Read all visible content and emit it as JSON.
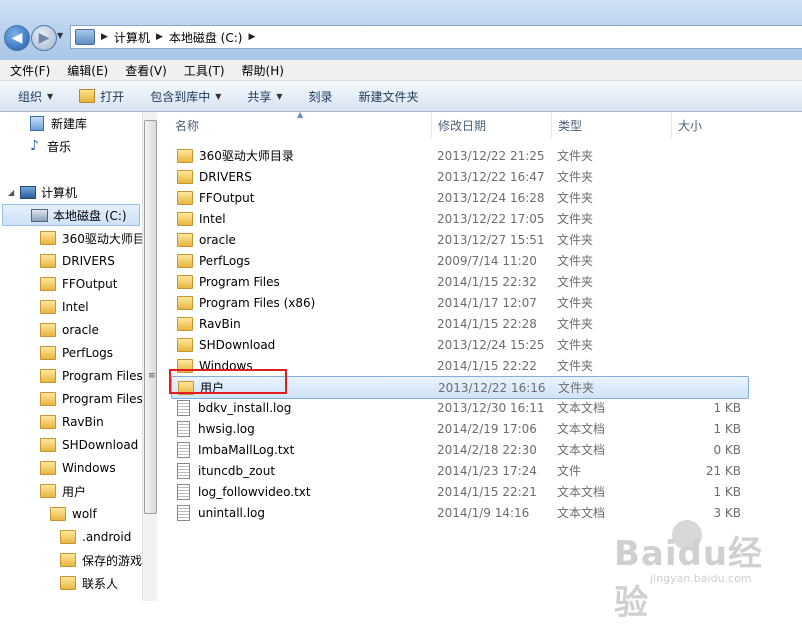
{
  "address": {
    "crumbs": [
      "计算机",
      "本地磁盘 (C:)"
    ]
  },
  "menubar": [
    "文件(F)",
    "编辑(E)",
    "查看(V)",
    "工具(T)",
    "帮助(H)"
  ],
  "toolbar": {
    "organize": "组织",
    "open": "打开",
    "include_library": "包含到库中",
    "share": "共享",
    "burn": "刻录",
    "new_folder": "新建文件夹"
  },
  "nav": {
    "new_library": "新建库",
    "music": "音乐",
    "computer": "计算机",
    "local_disk": "本地磁盘 (C:)",
    "folders": [
      "360驱动大师目",
      "DRIVERS",
      "FFOutput",
      "Intel",
      "oracle",
      "PerfLogs",
      "Program Files",
      "Program Files",
      "RavBin",
      "SHDownload",
      "Windows",
      "用户"
    ],
    "user_folder": "wolf",
    "user_children": [
      ".android",
      "保存的游戏",
      "联系人"
    ]
  },
  "columns": {
    "name": "名称",
    "modified": "修改日期",
    "type": "类型",
    "size": "大小"
  },
  "files": [
    {
      "name": "360驱动大师目录",
      "date": "2013/12/22 21:25",
      "type": "文件夹",
      "size": "",
      "kind": "folder"
    },
    {
      "name": "DRIVERS",
      "date": "2013/12/22 16:47",
      "type": "文件夹",
      "size": "",
      "kind": "folder"
    },
    {
      "name": "FFOutput",
      "date": "2013/12/24 16:28",
      "type": "文件夹",
      "size": "",
      "kind": "folder"
    },
    {
      "name": "Intel",
      "date": "2013/12/22 17:05",
      "type": "文件夹",
      "size": "",
      "kind": "folder"
    },
    {
      "name": "oracle",
      "date": "2013/12/27 15:51",
      "type": "文件夹",
      "size": "",
      "kind": "folder"
    },
    {
      "name": "PerfLogs",
      "date": "2009/7/14 11:20",
      "type": "文件夹",
      "size": "",
      "kind": "folder"
    },
    {
      "name": "Program Files",
      "date": "2014/1/15 22:32",
      "type": "文件夹",
      "size": "",
      "kind": "folder"
    },
    {
      "name": "Program Files (x86)",
      "date": "2014/1/17 12:07",
      "type": "文件夹",
      "size": "",
      "kind": "folder"
    },
    {
      "name": "RavBin",
      "date": "2014/1/15 22:28",
      "type": "文件夹",
      "size": "",
      "kind": "folder"
    },
    {
      "name": "SHDownload",
      "date": "2013/12/24 15:25",
      "type": "文件夹",
      "size": "",
      "kind": "folder"
    },
    {
      "name": "Windows",
      "date": "2014/1/15 22:22",
      "type": "文件夹",
      "size": "",
      "kind": "folder"
    },
    {
      "name": "用户",
      "date": "2013/12/22 16:16",
      "type": "文件夹",
      "size": "",
      "kind": "folder",
      "selected": true
    },
    {
      "name": "bdkv_install.log",
      "date": "2013/12/30 16:11",
      "type": "文本文档",
      "size": "1 KB",
      "kind": "file"
    },
    {
      "name": "hwsig.log",
      "date": "2014/2/19 17:06",
      "type": "文本文档",
      "size": "1 KB",
      "kind": "file"
    },
    {
      "name": "ImbaMallLog.txt",
      "date": "2014/2/18 22:30",
      "type": "文本文档",
      "size": "0 KB",
      "kind": "file"
    },
    {
      "name": "ituncdb_zout",
      "date": "2014/1/23 17:24",
      "type": "文件",
      "size": "21 KB",
      "kind": "file"
    },
    {
      "name": "log_followvideo.txt",
      "date": "2014/1/15 22:21",
      "type": "文本文档",
      "size": "1 KB",
      "kind": "file"
    },
    {
      "name": "unintall.log",
      "date": "2014/1/9 14:16",
      "type": "文本文档",
      "size": "3 KB",
      "kind": "file"
    }
  ],
  "watermark": {
    "main": "Baidu经验",
    "sub": "jingyan.baidu.com"
  },
  "colors": {
    "highlight_box": "#e01e1e",
    "selection": "#cfe3f9"
  }
}
